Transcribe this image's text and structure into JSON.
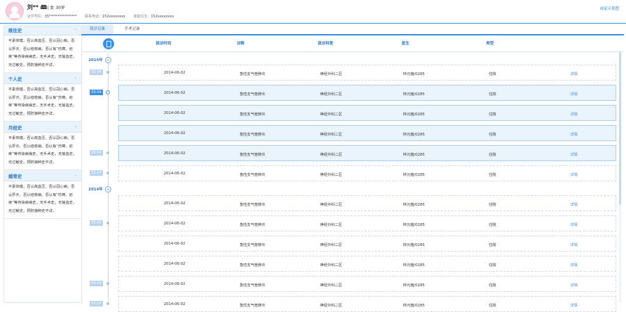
{
  "patient": {
    "name": "刘** 🕮",
    "gender_age": "| 女 30岁",
    "id_label": "证件号码：",
    "id_value": "35****************",
    "contact_label": "联系电话：",
    "contact_value": "152xxxxxxxx",
    "home_label": "家庭住址：",
    "home_value": "152xxxxxxxx"
  },
  "header": {
    "custom_view": "自定义视图"
  },
  "sidebar": {
    "sections": [
      {
        "title": "既往史",
        "text": "平素体健，否认高血压、否认冠心病、否认肝炎、否认结核病、否认有“伤寒、疟疾”等传染病病史，无手术史，无输血史，无过敏史，预防接种史不详。"
      },
      {
        "title": "个人史",
        "text": "平素体健，否认高血压、否认冠心病、否认肝炎、否认结核病、否认有“伤寒、疟疾”等传染病病史，无手术史，无输血史，无过敏史，预防接种史不详。"
      },
      {
        "title": "月经史",
        "text": "平素体健，否认高血压、否认冠心病、否认肝炎、否认结核病、否认有“伤寒、疟疾”等传染病病史，无手术史，无输血史，无过敏史，预防接种史不详。"
      },
      {
        "title": "婚育史",
        "text": "平素体健，否认高血压、否认冠心病、否认肝炎、否认结核病、否认有“伤寒、疟疾”等传染病病史，无手术史，无输血史，无过敏史，预防接种史不详。"
      }
    ],
    "collapse_glyph": "⌄"
  },
  "tabs": [
    "就诊记录",
    "手术记录"
  ],
  "table": {
    "columns": [
      "就诊时间",
      "诊断",
      "就诊科室",
      "医生",
      "类型"
    ],
    "detail_label": "详情"
  },
  "years": [
    "2015年",
    "2014年"
  ],
  "records": [
    {
      "badge": "03.04",
      "date": "2014-06-02",
      "diagnosis": "急性支气管肺炎",
      "dept": "神经外科二区",
      "doctor": "林元植/0285",
      "type": "住院"
    },
    {
      "badge": "03.04",
      "date": "2014-06-02",
      "diagnosis": "急性支气管肺炎",
      "dept": "神经外科二区",
      "doctor": "林元植/0285",
      "type": "住院"
    },
    {
      "badge": "",
      "date": "2014-06-02",
      "diagnosis": "急性支气管肺炎",
      "dept": "神经外科二区",
      "doctor": "林元植/0285",
      "type": "住院"
    },
    {
      "badge": "",
      "date": "2014-06-02",
      "diagnosis": "急性支气管肺炎",
      "dept": "神经外科二区",
      "doctor": "林元植/0285",
      "type": "住院"
    },
    {
      "badge": "03.04",
      "date": "2014-06-02",
      "diagnosis": "急性支气管肺炎",
      "dept": "神经外科二区",
      "doctor": "林元植/0285",
      "type": "住院"
    },
    {
      "badge": "03.04",
      "date": "2014-06-02",
      "diagnosis": "急性支气管肺炎",
      "dept": "神经外科二区",
      "doctor": "林元植/0285",
      "type": "住院"
    },
    {
      "badge": "",
      "date": "2014-06-02",
      "diagnosis": "急性支气管肺炎",
      "dept": "神经外科二区",
      "doctor": "林元植/0285",
      "type": "住院"
    },
    {
      "badge": "03.04",
      "date": "2014-06-02",
      "diagnosis": "急性支气管肺炎",
      "dept": "神经外科二区",
      "doctor": "林元植/0285",
      "type": "住院"
    },
    {
      "badge": "",
      "date": "2014-06-02",
      "diagnosis": "急性支气管肺炎",
      "dept": "神经外科二区",
      "doctor": "林元植/0285",
      "type": "住院"
    },
    {
      "badge": "",
      "date": "2014-06-02",
      "diagnosis": "急性支气管肺炎",
      "dept": "神经外科二区",
      "doctor": "林元植/0285",
      "type": "住院"
    },
    {
      "badge": "03.04",
      "date": "2014-06-02",
      "diagnosis": "急性支气管肺炎",
      "dept": "神经外科二区",
      "doctor": "林元植/0285",
      "type": "住院"
    },
    {
      "badge": "03.04",
      "date": "2014-06-02",
      "diagnosis": "急性支气管肺炎",
      "dept": "神经外科二区",
      "doctor": "林元植/0285",
      "type": "住院"
    }
  ],
  "colors": {
    "accent": "#3a8ee6",
    "selected_row": "#eaf4fc",
    "badge_inactive": "#b7d3ef"
  }
}
